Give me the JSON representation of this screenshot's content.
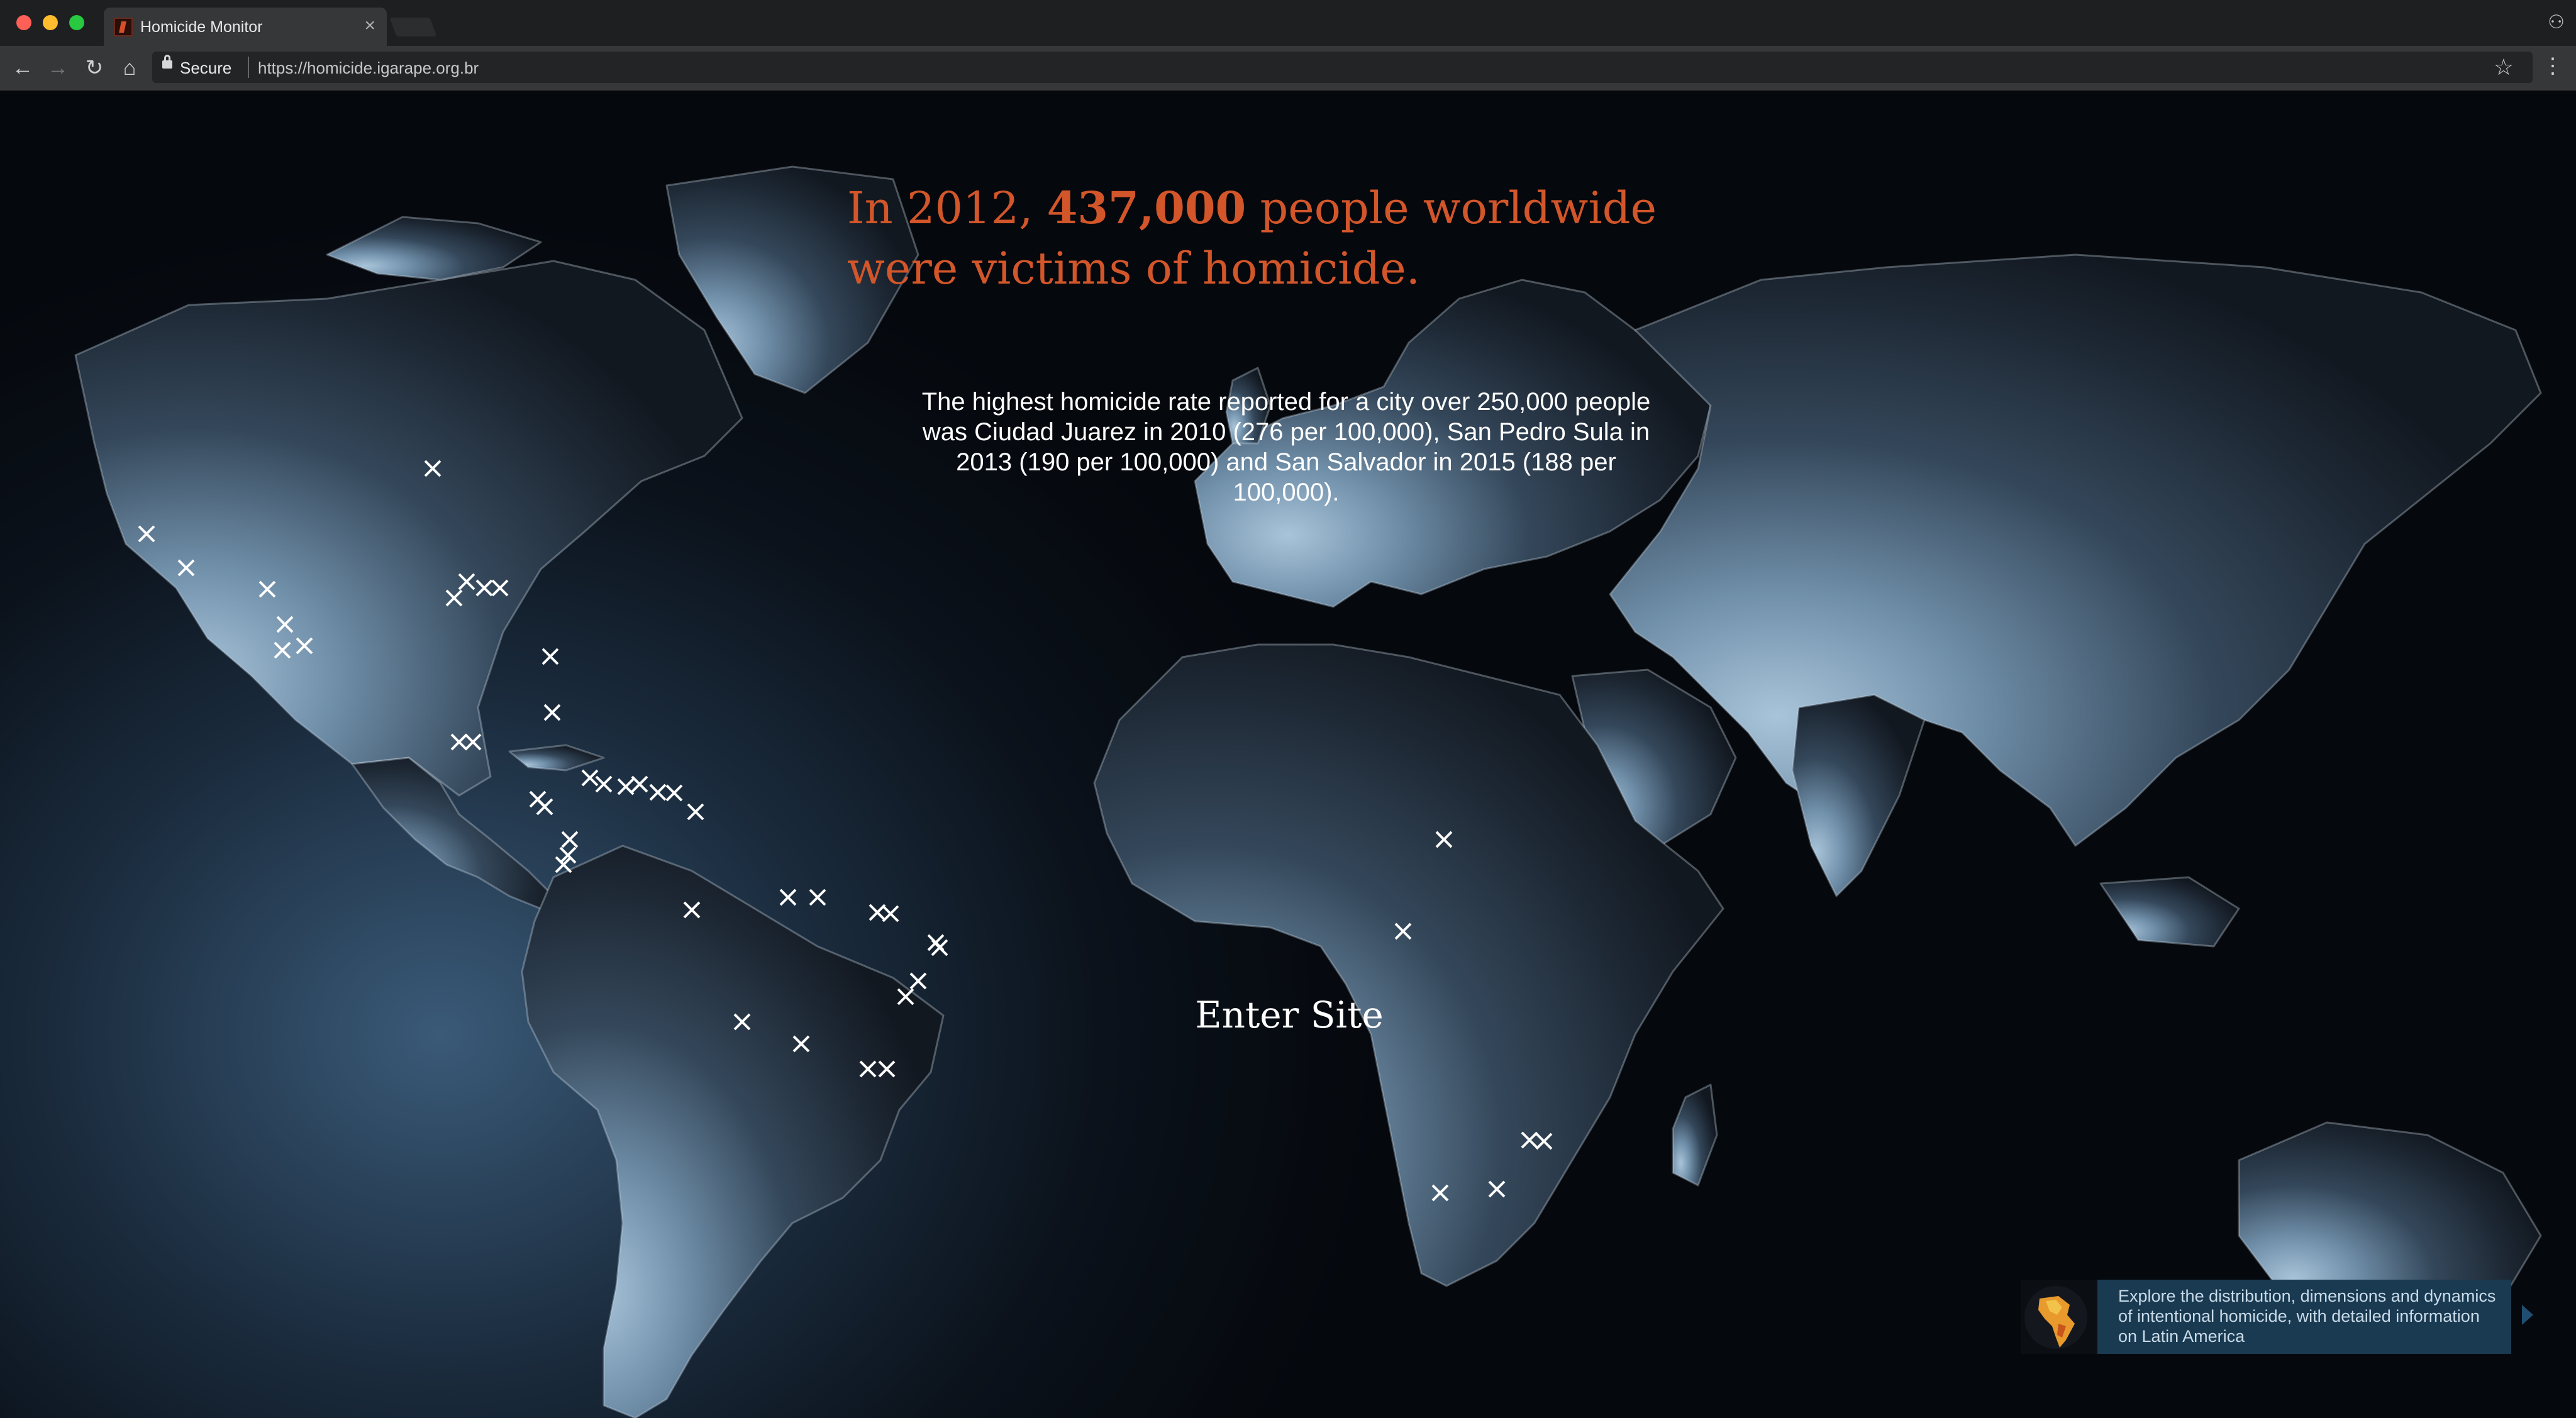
{
  "browser": {
    "tab_title": "Homicide Monitor",
    "secure_label": "Secure",
    "url": "https://homicide.igarape.org.br"
  },
  "hero": {
    "headline_prefix": "In 2012, ",
    "headline_number": "437,000",
    "headline_suffix": " people worldwide were victims of homicide.",
    "subtext": "The highest homicide rate reported for a city over 250,000 people was Ciudad Juarez in 2010 (276 per 100,000), San Pedro Sula in 2013 (190 per 100,000) and San Salvador in 2015 (188 per 100,000).",
    "enter_label": "Enter Site"
  },
  "promo": {
    "text": "Explore the distribution, dimensions and dynamics of intentional homicide, with detailed information on Latin America"
  },
  "colors": {
    "accent": "#d2562a",
    "marker": "#ffffff",
    "promo_bg": "#1a3a52"
  },
  "icons": [
    "back-arrow-icon",
    "forward-arrow-icon",
    "reload-icon",
    "home-icon",
    "lock-icon",
    "star-icon",
    "menu-icon",
    "close-icon",
    "marker-x-icon",
    "globe-icon",
    "chevron-right-icon"
  ]
}
